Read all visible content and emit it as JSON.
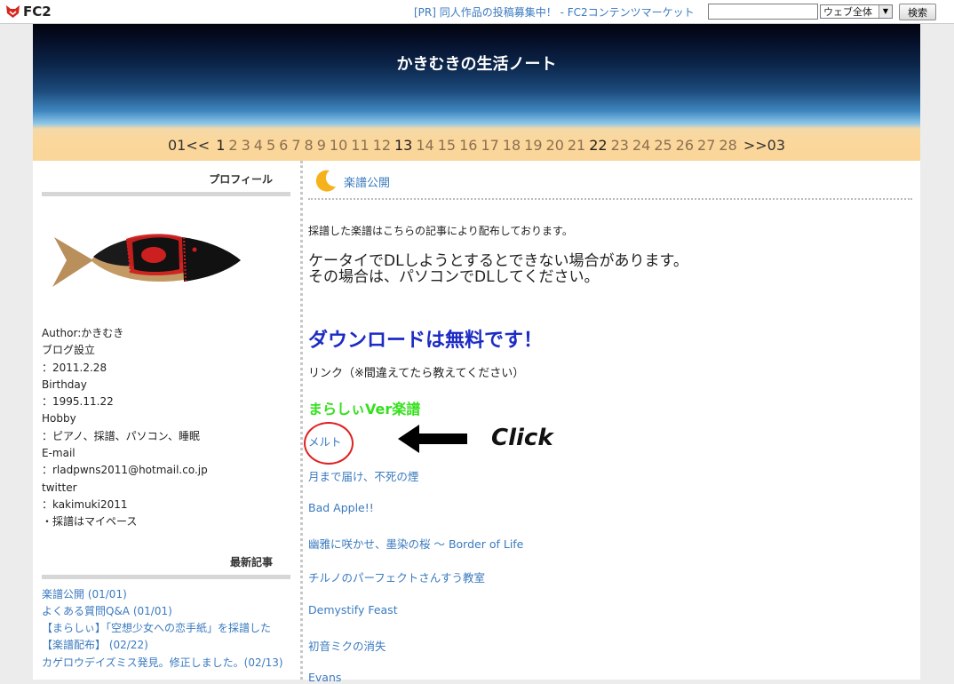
{
  "topbar": {
    "logo_text": "FC2",
    "pr_link": "[PR] 同人作品の投稿募集中！ - FC2コンテンツマーケット",
    "search_value": "",
    "scope_select": "ウェブ全体",
    "search_button": "検索"
  },
  "header": {
    "title": "かきむきの生活ノート",
    "pager_prev": "01<<",
    "pager_next": ">>03",
    "days": [
      "1",
      "2",
      "3",
      "4",
      "5",
      "6",
      "7",
      "8",
      "9",
      "10",
      "11",
      "12",
      "13",
      "14",
      "15",
      "16",
      "17",
      "18",
      "19",
      "20",
      "21",
      "22",
      "23",
      "24",
      "25",
      "26",
      "27",
      "28"
    ],
    "active_days": [
      "1",
      "13",
      "22"
    ]
  },
  "sidebar": {
    "profile_heading": "プロフィール",
    "profile_lines": [
      "Author:かきむき",
      "ブログ設立",
      "：2011.2.28",
      "Birthday",
      "：1995.11.22",
      "Hobby",
      "：ピアノ、採譜、パソコン、睡眠",
      "E-mail",
      "：rladpwns2011@hotmail.co.jp",
      "twitter",
      "：kakimuki2011",
      "・採譜はマイペース"
    ],
    "recent_heading": "最新記事",
    "recent_entries": [
      "楽譜公開 (01/01)",
      "よくある質問Q&A (01/01)",
      "【まらしぃ】「空想少女への恋手紙」を採譜した【楽譜配布】 (02/22)",
      "カゲロウデイズミス発見。修正しました。(02/13)"
    ]
  },
  "entry": {
    "title": "楽譜公開",
    "intro": "採譜した楽譜はこちらの記事により配布しております。",
    "warning_line1": "ケータイでDLしようとするとできない場合があります。",
    "warning_line2": "その場合は、パソコンでDLしてください。",
    "free_notice": "ダウンロードは無料です！",
    "link_note": "リンク（※間違えてたら教えてください）",
    "version_heading": "まらしぃVer楽譜",
    "songs": [
      "メルト",
      "月まで届け、不死の煙",
      "Bad Apple!!",
      "幽雅に咲かせ、墨染の桜 ～ Border of Life",
      "チルノのパーフェクトさんすう教室",
      "Demystify Feast",
      "初音ミクの消失",
      "Evans"
    ],
    "click_annotation": "Click"
  }
}
